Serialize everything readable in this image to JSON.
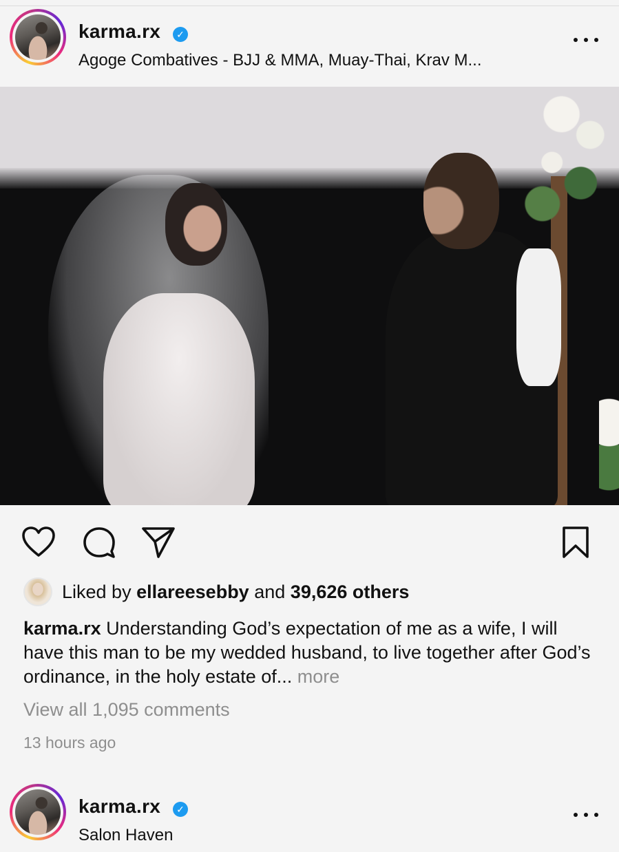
{
  "posts": [
    {
      "username": "karma.rx",
      "verified": true,
      "location": "Agoge Combatives - BJJ & MMA, Muay-Thai, Krav M...",
      "liked_by_prefix": "Liked by",
      "liked_by_user": "ellareesebby",
      "liked_and": "and",
      "liked_others": "39,626 others",
      "caption_user": "karma.rx",
      "caption_text": "Understanding God’s expectation of me as a wife, I will have this man to be my wedded husband, to live together after God’s ordinance, in the holy estate of...",
      "caption_more": "more",
      "view_comments": "View all 1,095 comments",
      "timestamp": "13 hours ago"
    },
    {
      "username": "karma.rx",
      "verified": true,
      "location": "Salon Haven"
    }
  ],
  "icons": {
    "more": "more-horizontal-icon",
    "like": "heart-icon",
    "comment": "comment-bubble-icon",
    "share": "send-paper-plane-icon",
    "save": "bookmark-icon",
    "verified": "verified-badge-icon"
  },
  "colors": {
    "verified": "#1d9bf0",
    "muted_text": "#8e8e8e",
    "background": "#f4f4f4"
  }
}
